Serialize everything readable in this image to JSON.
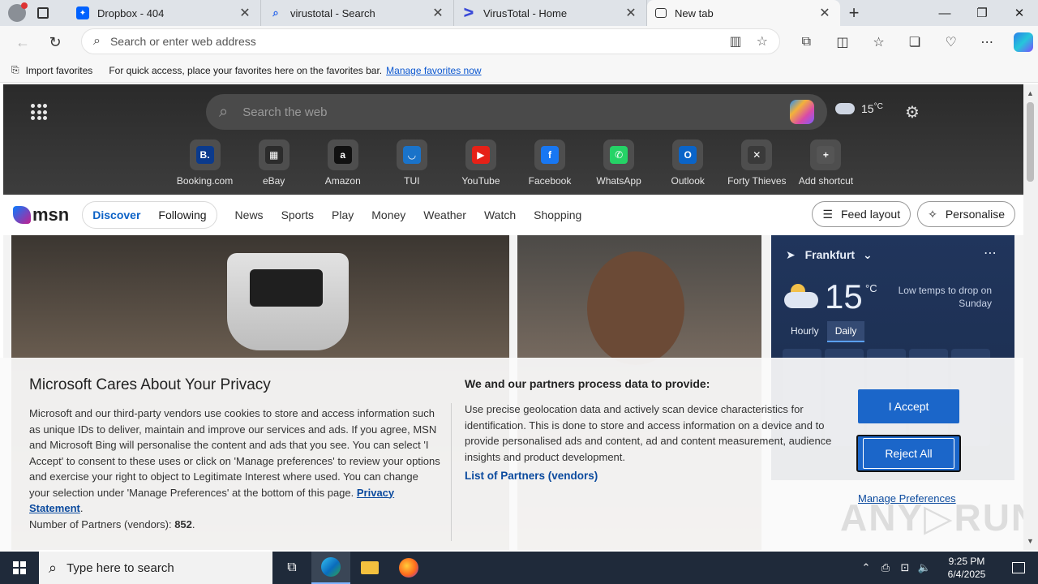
{
  "browser": {
    "tabs": [
      {
        "title": "Dropbox - 404",
        "icon": "dropbox-icon",
        "active": false
      },
      {
        "title": "virustotal - Search",
        "icon": "search-icon",
        "active": false
      },
      {
        "title": "VirusTotal - Home",
        "icon": "virustotal-icon",
        "active": false
      },
      {
        "title": "New tab",
        "icon": "newtab-icon",
        "active": true
      }
    ],
    "address_placeholder": "Search or enter web address",
    "favorites_bar": {
      "import_label": "Import favorites",
      "message": "For quick access, place your favorites here on the favorites bar.",
      "link": "Manage favorites now"
    }
  },
  "newtab": {
    "search_placeholder": "Search the web",
    "weather_temp": "15",
    "weather_unit": "°C",
    "shortcuts": [
      {
        "label": "Booking.com",
        "color": "#0b3a8c",
        "glyph": "B."
      },
      {
        "label": "eBay",
        "color": "#2c2c2c",
        "glyph": "▦"
      },
      {
        "label": "Amazon",
        "color": "#111111",
        "glyph": "a"
      },
      {
        "label": "TUI",
        "color": "#1a73c9",
        "glyph": "◡"
      },
      {
        "label": "YouTube",
        "color": "#e62117",
        "glyph": "▶"
      },
      {
        "label": "Facebook",
        "color": "#1877f2",
        "glyph": "f"
      },
      {
        "label": "WhatsApp",
        "color": "#25d366",
        "glyph": "✆"
      },
      {
        "label": "Outlook",
        "color": "#0a64c8",
        "glyph": "O"
      },
      {
        "label": "Forty Thieves",
        "color": "#3a3a3a",
        "glyph": "✕"
      },
      {
        "label": "Add shortcut",
        "color": "#555555",
        "glyph": "+"
      }
    ],
    "msn": {
      "logo": "msn",
      "pill": [
        "Discover",
        "Following"
      ],
      "nav": [
        "News",
        "Sports",
        "Play",
        "Money",
        "Weather",
        "Watch",
        "Shopping"
      ],
      "feed_layout": "Feed layout",
      "personalise": "Personalise"
    },
    "weather_card": {
      "city": "Frankfurt",
      "temp": "15",
      "unit": "°C",
      "note": "Low temps to drop on Sunday",
      "tabs": [
        "Hourly",
        "Daily"
      ]
    }
  },
  "privacy": {
    "title": "Microsoft Cares About Your Privacy",
    "body": "Microsoft and our third-party vendors use cookies to store and access information such as unique IDs to deliver, maintain and improve our services and ads. If you agree, MSN and Microsoft Bing will personalise the content and ads that you see. You can select 'I Accept' to consent to these uses or click on 'Manage preferences' to review your options and exercise your right to object to Legitimate Interest where used.  You can change your selection under 'Manage Preferences' at the bottom of this page. ",
    "privacy_link": "Privacy Statement",
    "partners_label": "Number of Partners (vendors): ",
    "partners_count": "852",
    "mid_title": "We and our partners process data to provide:",
    "mid_body": "Use precise geolocation data and actively scan device characteristics for identification. This is done to store and access information on a device and to provide personalised ads and content, ad and content measurement, audience insights and product development.",
    "list_link": "List of Partners (vendors)",
    "accept": "I Accept",
    "reject": "Reject All",
    "manage": "Manage Preferences"
  },
  "watermark": "ANY RUN",
  "taskbar": {
    "search_placeholder": "Type here to search",
    "time": "9:25 PM",
    "date": "6/4/2025"
  }
}
